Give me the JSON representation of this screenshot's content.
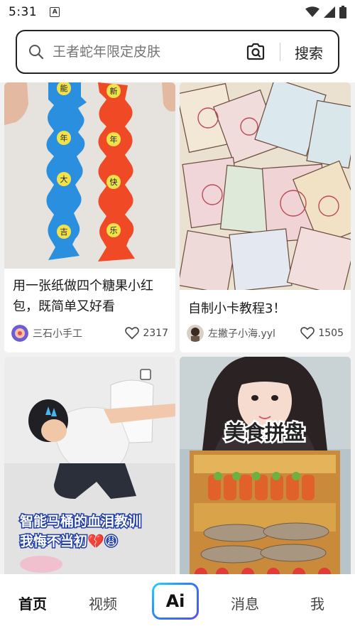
{
  "status_bar": {
    "time": "5:31",
    "app_badge": "A"
  },
  "search": {
    "placeholder": "王者蛇年限定皮肤",
    "button_label": "搜索"
  },
  "feed": {
    "cards": [
      {
        "title": "用一张纸做四个糖果小红包，既简单又好看",
        "author": "三石小手工",
        "likes": "2317",
        "image_chars": [
          "能",
          "年",
          "大",
          "吉",
          "新",
          "年",
          "快",
          "乐"
        ]
      },
      {
        "title": "自制小卡教程3！",
        "author": "左撇子小海.yyl",
        "likes": "1505"
      },
      {
        "title": "",
        "overlay_line1": "智能马桶的血泪教训",
        "overlay_line2": "我悔不当初💔😩"
      },
      {
        "title": "",
        "overlay_line1": "美食拼盘"
      }
    ]
  },
  "bottom_nav": {
    "home": "首页",
    "video": "视频",
    "ai": "Ai",
    "messages": "消息",
    "me": "我"
  }
}
